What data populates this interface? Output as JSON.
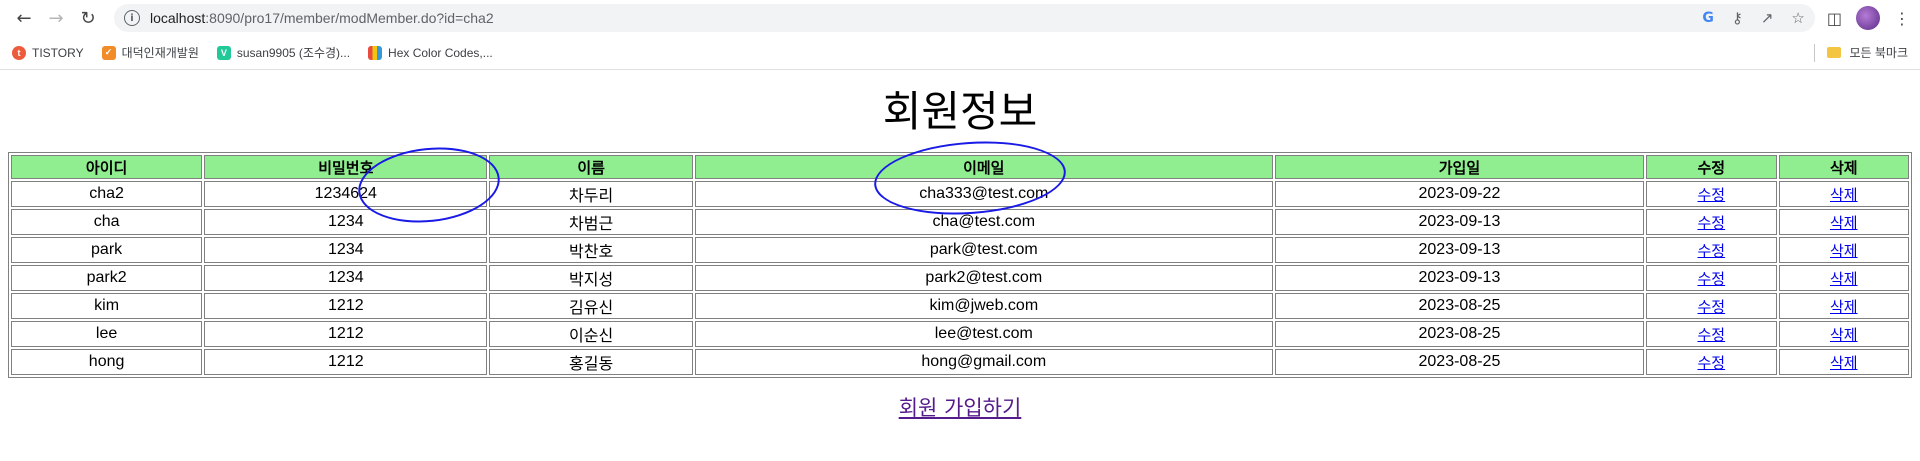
{
  "browser": {
    "url_host": "localhost",
    "url_path": ":8090/pro17/member/modMember.do?id=cha2",
    "bookmarks": [
      {
        "label": "TISTORY",
        "color": "#eb5b3c",
        "glyph": "t"
      },
      {
        "label": "대덕인재개발원",
        "color": "#f28c28",
        "glyph": "✓"
      },
      {
        "label": "susan9905 (조수경)...",
        "color": "#20c997",
        "glyph": "V"
      },
      {
        "label": "Hex Color Codes,...",
        "color": "#4b7bec",
        "glyph": "▮"
      }
    ],
    "all_bookmarks": "모든 북마크"
  },
  "page": {
    "title": "회원정보",
    "join_link": "회원 가입하기"
  },
  "table": {
    "headers": [
      "아이디",
      "비밀번호",
      "이름",
      "이메일",
      "가입일",
      "수정",
      "삭제"
    ],
    "rows": [
      [
        "cha2",
        "1234624",
        "차두리",
        "cha333@test.com",
        "2023-09-22",
        "수정",
        "삭제"
      ],
      [
        "cha",
        "1234",
        "차범근",
        "cha@test.com",
        "2023-09-13",
        "수정",
        "삭제"
      ],
      [
        "park",
        "1234",
        "박찬호",
        "park@test.com",
        "2023-09-13",
        "수정",
        "삭제"
      ],
      [
        "park2",
        "1234",
        "박지성",
        "park2@test.com",
        "2023-09-13",
        "수정",
        "삭제"
      ],
      [
        "kim",
        "1212",
        "김유신",
        "kim@jweb.com",
        "2023-08-25",
        "수정",
        "삭제"
      ],
      [
        "lee",
        "1212",
        "이순신",
        "lee@test.com",
        "2023-08-25",
        "수정",
        "삭제"
      ],
      [
        "hong",
        "1212",
        "홍길동",
        "hong@gmail.com",
        "2023-08-25",
        "수정",
        "삭제"
      ]
    ]
  },
  "colors": {
    "header_bg": "#90ee90",
    "link": "#0000ee",
    "visited_link": "#551a8b",
    "annotation": "#1a1ae6"
  }
}
